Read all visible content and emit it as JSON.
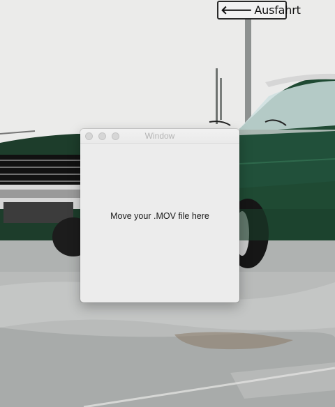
{
  "window": {
    "title": "Window",
    "drop_message": "Move your .MOV file here",
    "buttons": {
      "close": "close-button",
      "minimize": "minimize-button",
      "zoom": "zoom-button"
    }
  },
  "wallpaper": {
    "sign_text": "Ausfahrt",
    "sign_icon": "arrow-left-icon",
    "car_color": "#1f4a33"
  }
}
